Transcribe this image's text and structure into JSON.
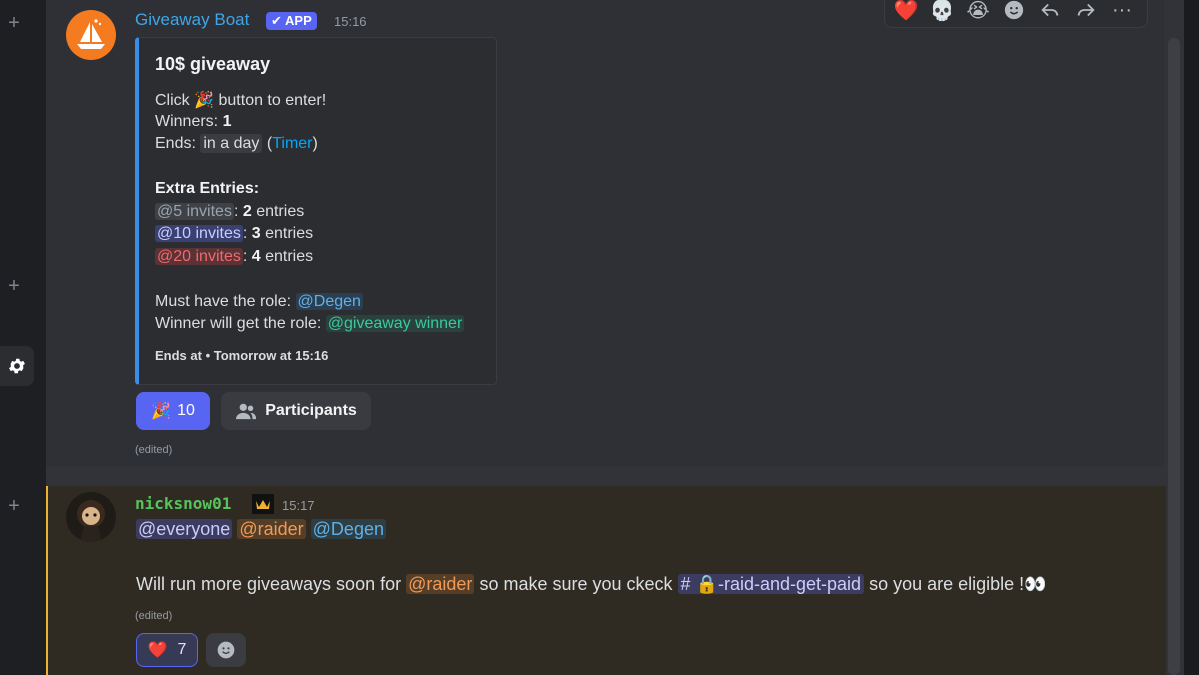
{
  "rail": {
    "plus_symbol": "+"
  },
  "toolbar": {
    "reactions": [
      "❤️",
      "💀",
      "😭"
    ],
    "icons": [
      "add-reaction-icon",
      "reply-icon",
      "forward-icon",
      "more-icon"
    ],
    "more_label": "···"
  },
  "message1": {
    "author": "Giveaway Boat",
    "app_tag": "✔ APP",
    "timestamp": "15:16",
    "embed": {
      "title": "10$ giveaway",
      "click_prefix": "Click",
      "click_emoji": "🎉",
      "click_suffix": "button to enter!",
      "winners_label": "Winners:",
      "winners_value": "1",
      "ends_label": "Ends:",
      "ends_value": "in a day",
      "timer_link": "Timer",
      "extra_entries_label": "Extra Entries:",
      "entries": [
        {
          "role": "@5 invites",
          "count": "2",
          "suffix": "entries"
        },
        {
          "role": "@10 invites",
          "count": "3",
          "suffix": "entries"
        },
        {
          "role": "@20 invites",
          "count": "4",
          "suffix": "entries"
        }
      ],
      "must_have_label": "Must have the role:",
      "must_have_role": "@Degen",
      "winner_gets_label": "Winner will get the role:",
      "winner_gets_role": "@giveaway winner",
      "footer": "Ends at • Tomorrow at 15:16"
    },
    "enter_button": {
      "emoji": "🎉",
      "count": "10"
    },
    "participants_button": "Participants",
    "edited": "(edited)"
  },
  "message2": {
    "author": "nicksnow01",
    "timestamp": "15:17",
    "mentions": [
      "@everyone",
      "@raider",
      "@Degen"
    ],
    "body": {
      "part1": "Will run more giveaways soon for",
      "mention": "@raider",
      "part2": "so make sure you ckeck",
      "channel": "# 🔒-raid-and-get-paid",
      "part3": "so you are eligible !",
      "emoji": "👀"
    },
    "edited": "(edited)",
    "reactions": [
      {
        "emoji": "❤️",
        "count": "7"
      }
    ]
  },
  "colors": {
    "blurple": "#5865f2",
    "author_blue": "#3ea6e6",
    "author_green": "#57c35b",
    "embed_border": "#3a8ee6",
    "highlight_border": "#f0b232"
  }
}
